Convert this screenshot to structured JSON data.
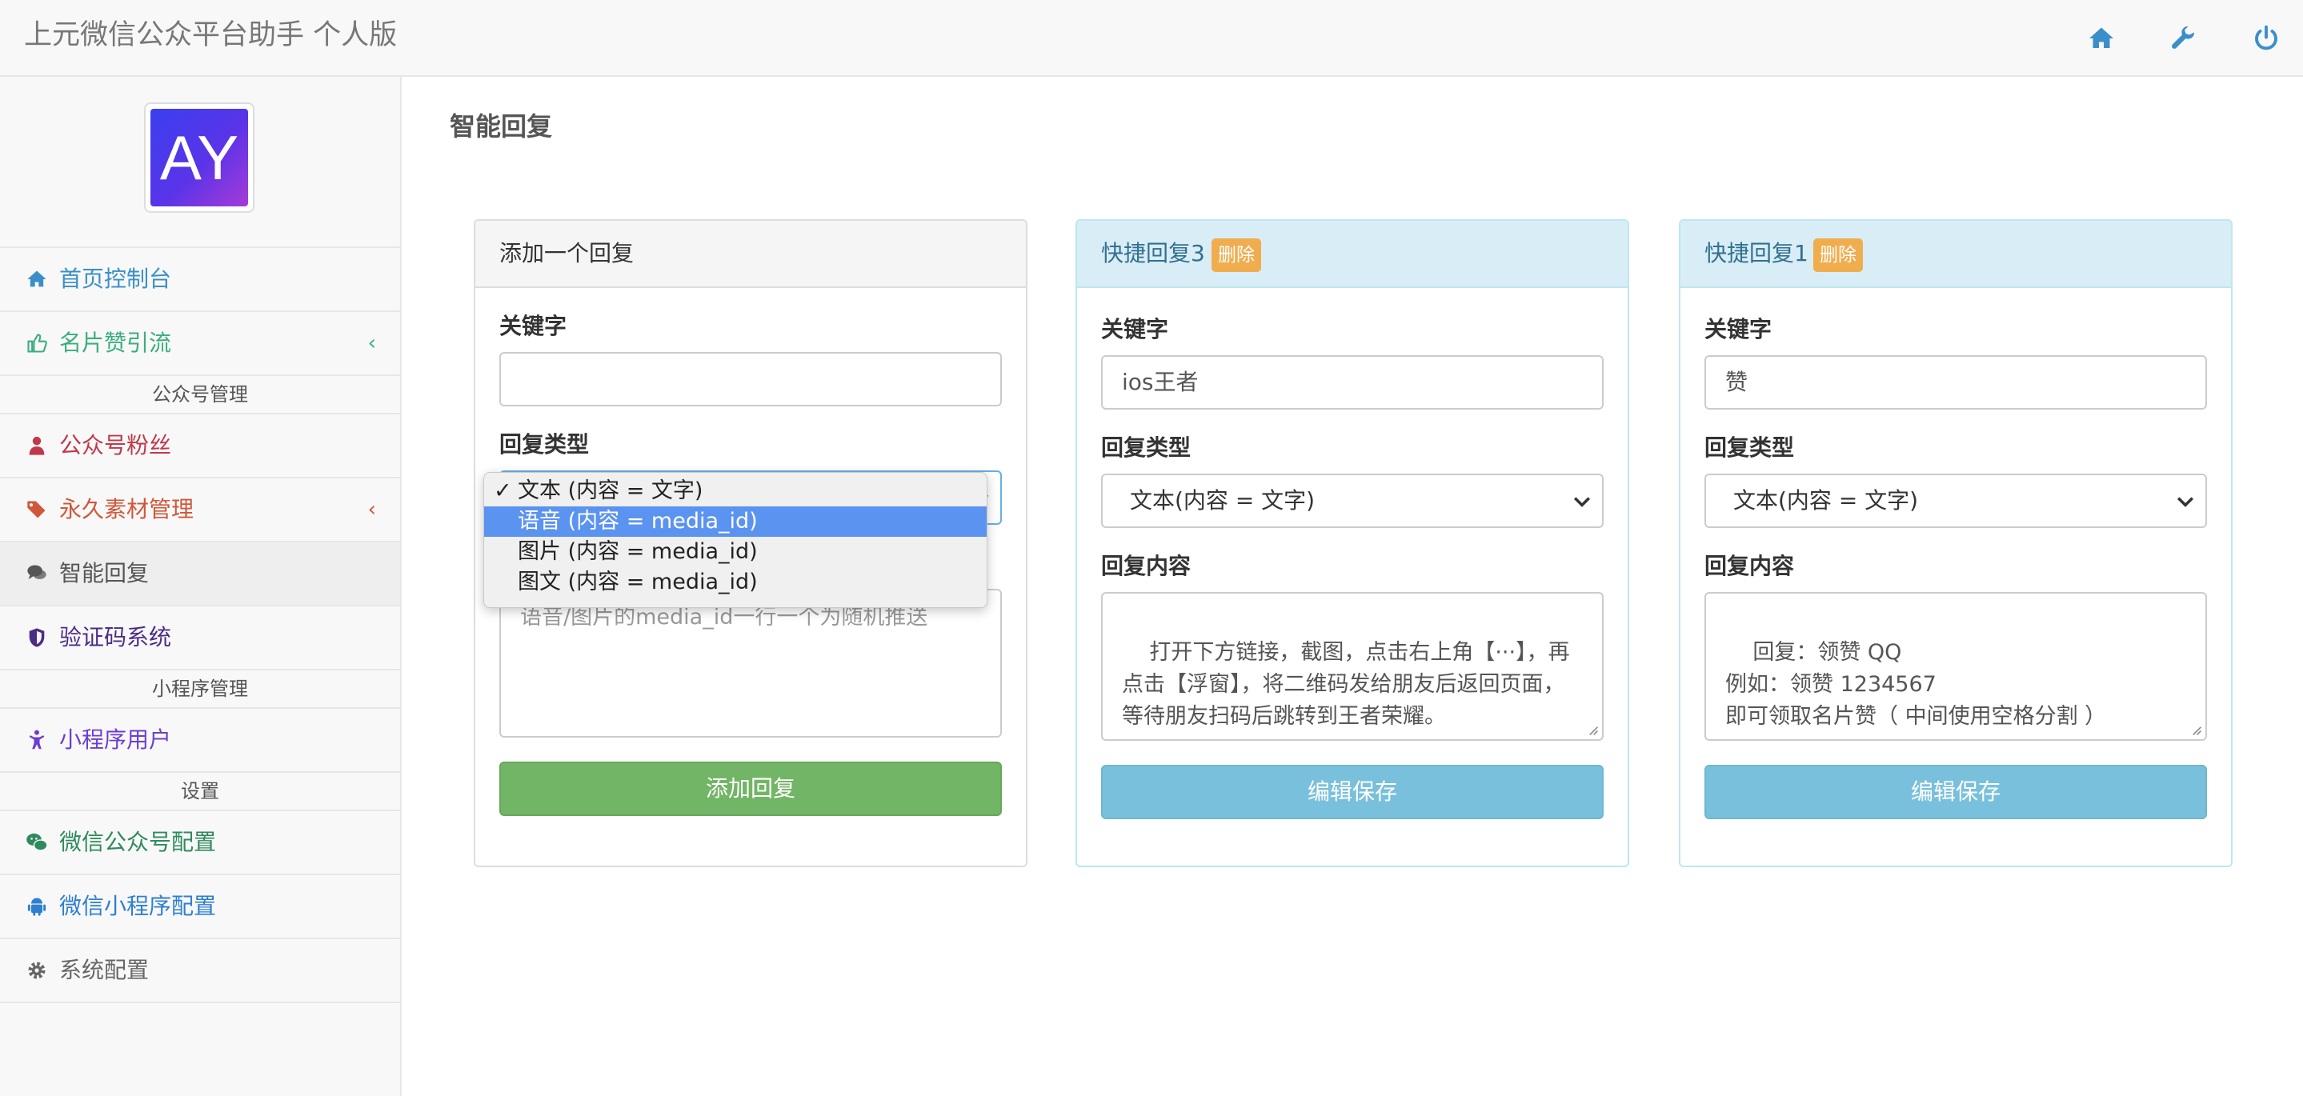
{
  "app": {
    "title": "上元微信公众平台助手 个人版"
  },
  "navbar": {
    "icons": [
      "home-icon",
      "wrench-icon",
      "power-icon"
    ]
  },
  "sidebar": {
    "logo_text": "AY",
    "items": [
      {
        "label": "首页控制台",
        "icon": "home-icon",
        "color": "#3a8fc9"
      },
      {
        "label": "名片赞引流",
        "icon": "thumbs-up-icon",
        "color": "#3aae7e",
        "chevron": "‹"
      },
      {
        "label": "公众号粉丝",
        "icon": "user-icon",
        "color": "#c0394b"
      },
      {
        "label": "永久素材管理",
        "icon": "tags-icon",
        "color": "#d0583a",
        "chevron": "‹"
      },
      {
        "label": "智能回复",
        "icon": "comments-icon",
        "color": "#555555"
      },
      {
        "label": "验证码系统",
        "icon": "shield-icon",
        "color": "#4b2c86"
      },
      {
        "label": "小程序用户",
        "icon": "child-icon",
        "color": "#6c3fd1"
      },
      {
        "label": "微信公众号配置",
        "icon": "wechat-icon",
        "color": "#2f8a5c"
      },
      {
        "label": "微信小程序配置",
        "icon": "android-icon",
        "color": "#2f7fd0"
      },
      {
        "label": "系统配置",
        "icon": "gear-icon",
        "color": "#666666"
      }
    ],
    "headers": [
      "公众号管理",
      "小程序管理",
      "设置"
    ]
  },
  "main": {
    "page_title": "智能回复",
    "labels": {
      "keyword": "关键字",
      "reply_type": "回复类型",
      "reply_content": "回复内容"
    },
    "add_panel": {
      "title": "添加一个回复",
      "keyword_value": "",
      "textarea_placeholder": "语音/图片的media_id一行一个为随机推送",
      "button": "添加回复"
    },
    "panels": [
      {
        "title": "快捷回复3",
        "badge": "删除",
        "keyword_value": "ios王者",
        "reply_type_value": "文本(内容 = 文字)",
        "content": "打开下方链接，截图，点击右上角【···】，再点击【浮窗】，将二维码发给朋友后返回页面，等待朋友扫码后跳转到王者荣耀。",
        "button": "编辑保存"
      },
      {
        "title": "快捷回复1",
        "badge": "删除",
        "keyword_value": "赞",
        "reply_type_value": "文本(内容 = 文字)",
        "content": "回复：领赞 QQ\n例如：领赞 1234567\n即可领取名片赞（ 中间使用空格分割 ）",
        "button": "编辑保存"
      }
    ]
  },
  "dropdown": {
    "options": [
      "文本 (内容 = 文字)",
      "语音 (内容 = media_id)",
      "图片 (内容 = media_id)",
      "图文 (内容 = media_id)"
    ],
    "selected_index": 0,
    "highlighted_index": 1,
    "check_mark": "✓"
  }
}
